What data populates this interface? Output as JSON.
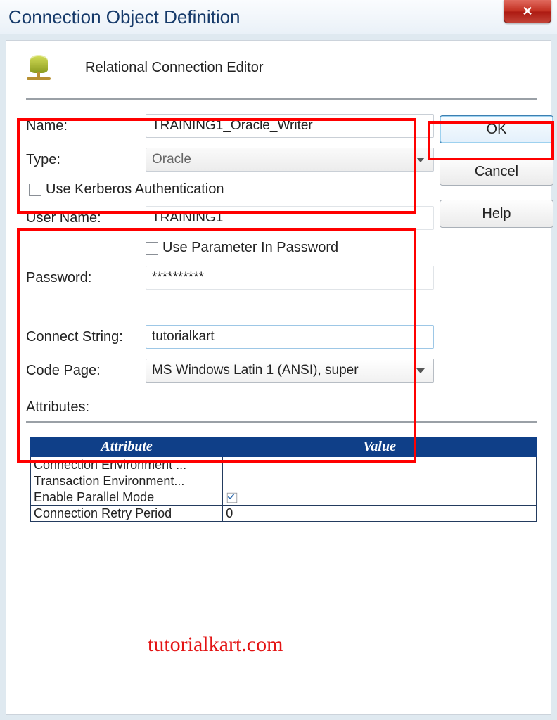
{
  "window": {
    "title": "Connection Object Definition"
  },
  "header": {
    "label": "Relational Connection Editor"
  },
  "form": {
    "name_label": "Name:",
    "name_value": "TRAINING1_Oracle_Writer",
    "type_label": "Type:",
    "type_value": "Oracle",
    "kerberos_label": "Use Kerberos Authentication",
    "username_label": "User Name:",
    "username_value": "TRAINING1",
    "use_param_pwd_label": "Use Parameter In Password",
    "password_label": "Password:",
    "password_value": "**********",
    "connect_string_label": "Connect String:",
    "connect_string_value": "tutorialkart",
    "code_page_label": "Code Page:",
    "code_page_value": "MS Windows Latin 1 (ANSI), super"
  },
  "buttons": {
    "ok": "OK",
    "cancel": "Cancel",
    "help": "Help"
  },
  "attributes_label": "Attributes:",
  "attributes_table": {
    "headers": {
      "attr": "Attribute",
      "val": "Value"
    },
    "rows": [
      {
        "attr": "Connection Environment ...",
        "val": ""
      },
      {
        "attr": "Transaction Environment...",
        "val": ""
      },
      {
        "attr": "Enable Parallel Mode",
        "val_check": true
      },
      {
        "attr": "Connection Retry Period",
        "val": "0"
      }
    ]
  },
  "watermark": "tutorialkart.com"
}
